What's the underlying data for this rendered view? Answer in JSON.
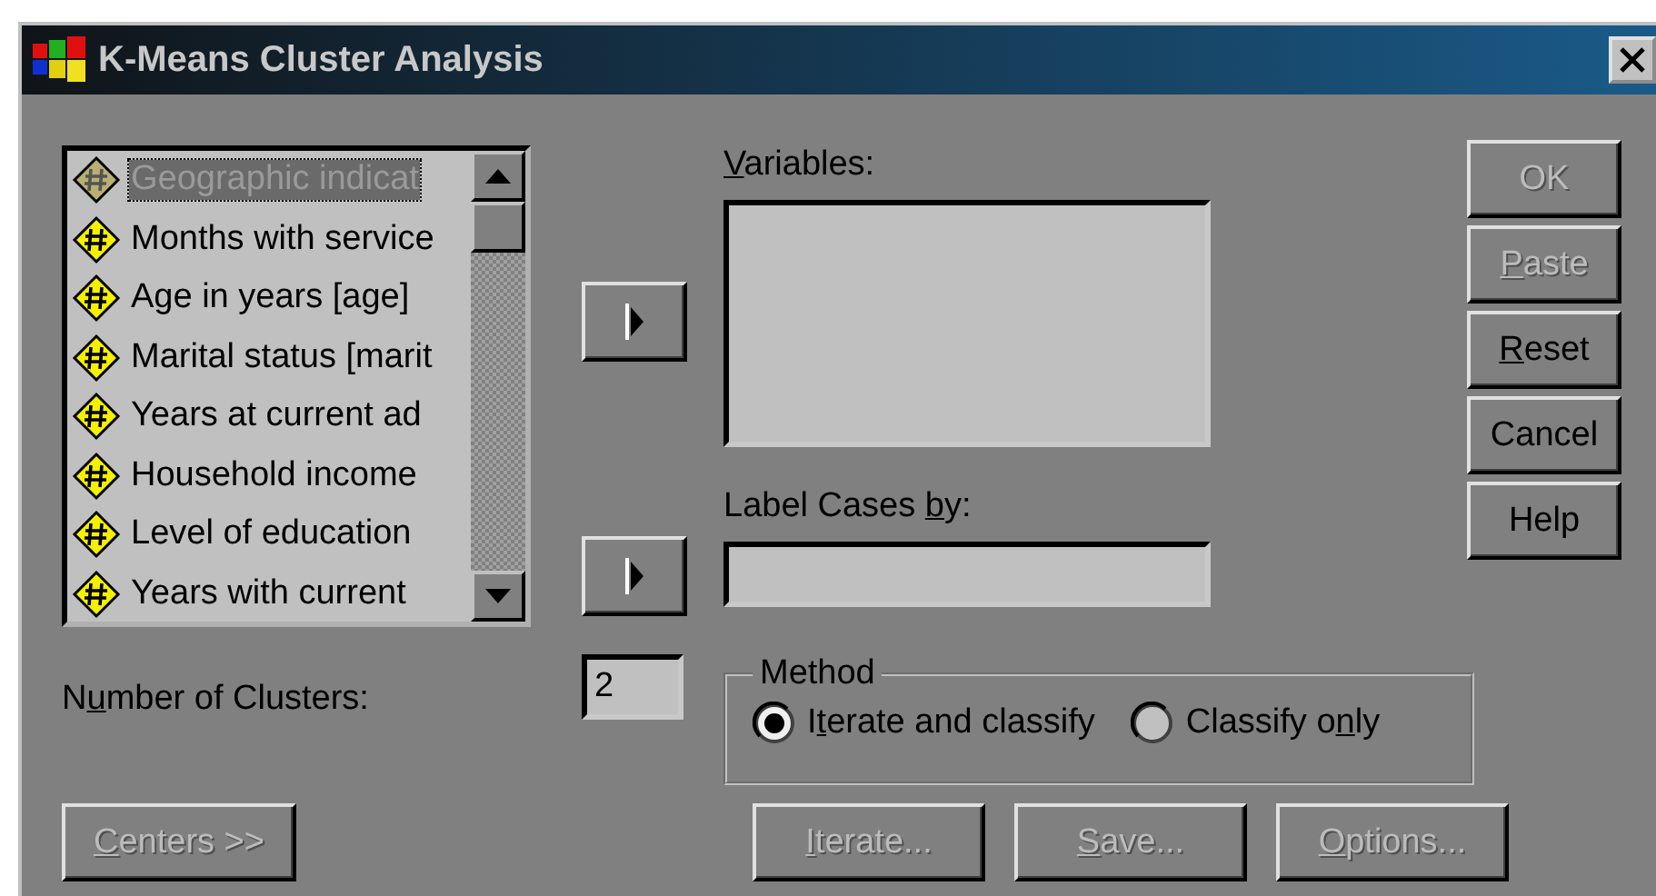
{
  "window": {
    "title": "K-Means Cluster Analysis"
  },
  "source_list": {
    "items": [
      {
        "label": "Geographic indicat",
        "selected": true
      },
      {
        "label": "Months with service",
        "selected": false
      },
      {
        "label": "Age in years [age]",
        "selected": false
      },
      {
        "label": "Marital status [marit",
        "selected": false
      },
      {
        "label": "Years at current ad",
        "selected": false
      },
      {
        "label": "Household income",
        "selected": false
      },
      {
        "label": "Level of education",
        "selected": false
      },
      {
        "label": "Years with current",
        "selected": false
      }
    ]
  },
  "variables": {
    "label": {
      "key": "V",
      "post": "ariables:"
    }
  },
  "label_cases_by": {
    "label": {
      "pre": "Label Cases ",
      "key": "b",
      "post": "y:"
    }
  },
  "number_of_clusters": {
    "label": {
      "pre": "N",
      "key": "u",
      "post": "mber of Clusters:"
    },
    "value": "2"
  },
  "method": {
    "title": "Method",
    "options": [
      {
        "label": {
          "pre": "I",
          "key": "t",
          "post": "erate and classify"
        },
        "selected": true
      },
      {
        "label": {
          "pre": "Classify o",
          "key": "n",
          "post": "ly"
        },
        "selected": false
      }
    ]
  },
  "side_buttons": [
    {
      "label": "OK",
      "disabled": true
    },
    {
      "label": {
        "key": "P",
        "post": "aste"
      },
      "disabled": true
    },
    {
      "label": {
        "key": "R",
        "post": "eset"
      },
      "disabled": false
    },
    {
      "label": "Cancel",
      "disabled": false
    },
    {
      "label": "Help",
      "disabled": false
    }
  ],
  "bottom_buttons": [
    {
      "label": {
        "key": "C",
        "post": "enters >>"
      },
      "disabled": true
    },
    {
      "label": {
        "key": "I",
        "post": "terate..."
      },
      "disabled": true
    },
    {
      "label": {
        "key": "S",
        "post": "ave..."
      },
      "disabled": true
    },
    {
      "label": {
        "key": "O",
        "post": "ptions..."
      },
      "disabled": true
    }
  ]
}
